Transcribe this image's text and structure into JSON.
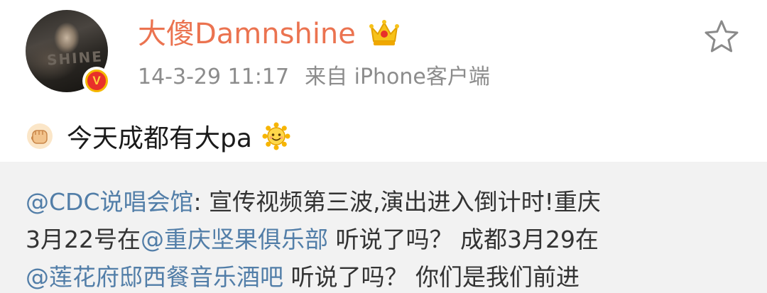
{
  "header": {
    "username": "大傻Damnshine",
    "avatar_text": "SHINE",
    "verified_badge": "V",
    "timestamp": "14-3-29 11:17",
    "source": "来自 iPhone客户端"
  },
  "post": {
    "text": "今天成都有大pa"
  },
  "repost": {
    "mention_1": "@CDC说唱会馆",
    "text_1": ": 宣传视频第三波,演出进入倒计时!重庆",
    "text_2a": "3月22号在",
    "mention_2": "@重庆坚果俱乐部",
    "text_2b": " 听说了吗？ 成都3月29在",
    "mention_3": "@莲花府邸西餐音乐酒吧",
    "text_3": " 听说了吗？ 你们是我们前进"
  },
  "colors": {
    "username": "#eb7350",
    "mention": "#527ea8",
    "timestamp": "#8c8c8c",
    "repost_bg": "#f2f2f2",
    "badge_red": "#e8302a",
    "badge_gold": "#f5b800"
  },
  "icons": [
    "crown-vip-icon",
    "verified-v-icon",
    "star-icon",
    "fist-emoji-icon",
    "sun-smile-emoji-icon"
  ]
}
